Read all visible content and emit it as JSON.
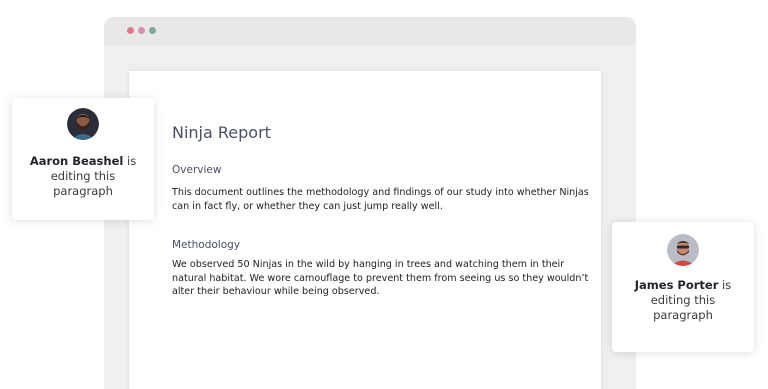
{
  "document": {
    "title": "Ninja Report",
    "sections": [
      {
        "heading": "Overview",
        "body": "This document outlines the methodology and findings of our study into whether Ninjas can in fact fly, or whether they can just jump really well."
      },
      {
        "heading": "Methodology",
        "body": "We observed 50 Ninjas in the wild by hanging in trees and watching them in their natural habitat. We wore camouflage to prevent them from seeing us so they wouldn’t alter their behaviour while being observed."
      }
    ]
  },
  "collaborators": [
    {
      "name": "Aaron Beashel",
      "status": "is editing this paragraph",
      "avatar_icon": "person-avatar"
    },
    {
      "name": "James Porter",
      "status": "is editing this paragraph",
      "avatar_icon": "person-avatar"
    }
  ],
  "colors": {
    "window_dot_red": "#e07a86",
    "window_dot_pink": "#d58fb0",
    "window_dot_green": "#7fa999",
    "heading_text": "#4a4f66"
  }
}
